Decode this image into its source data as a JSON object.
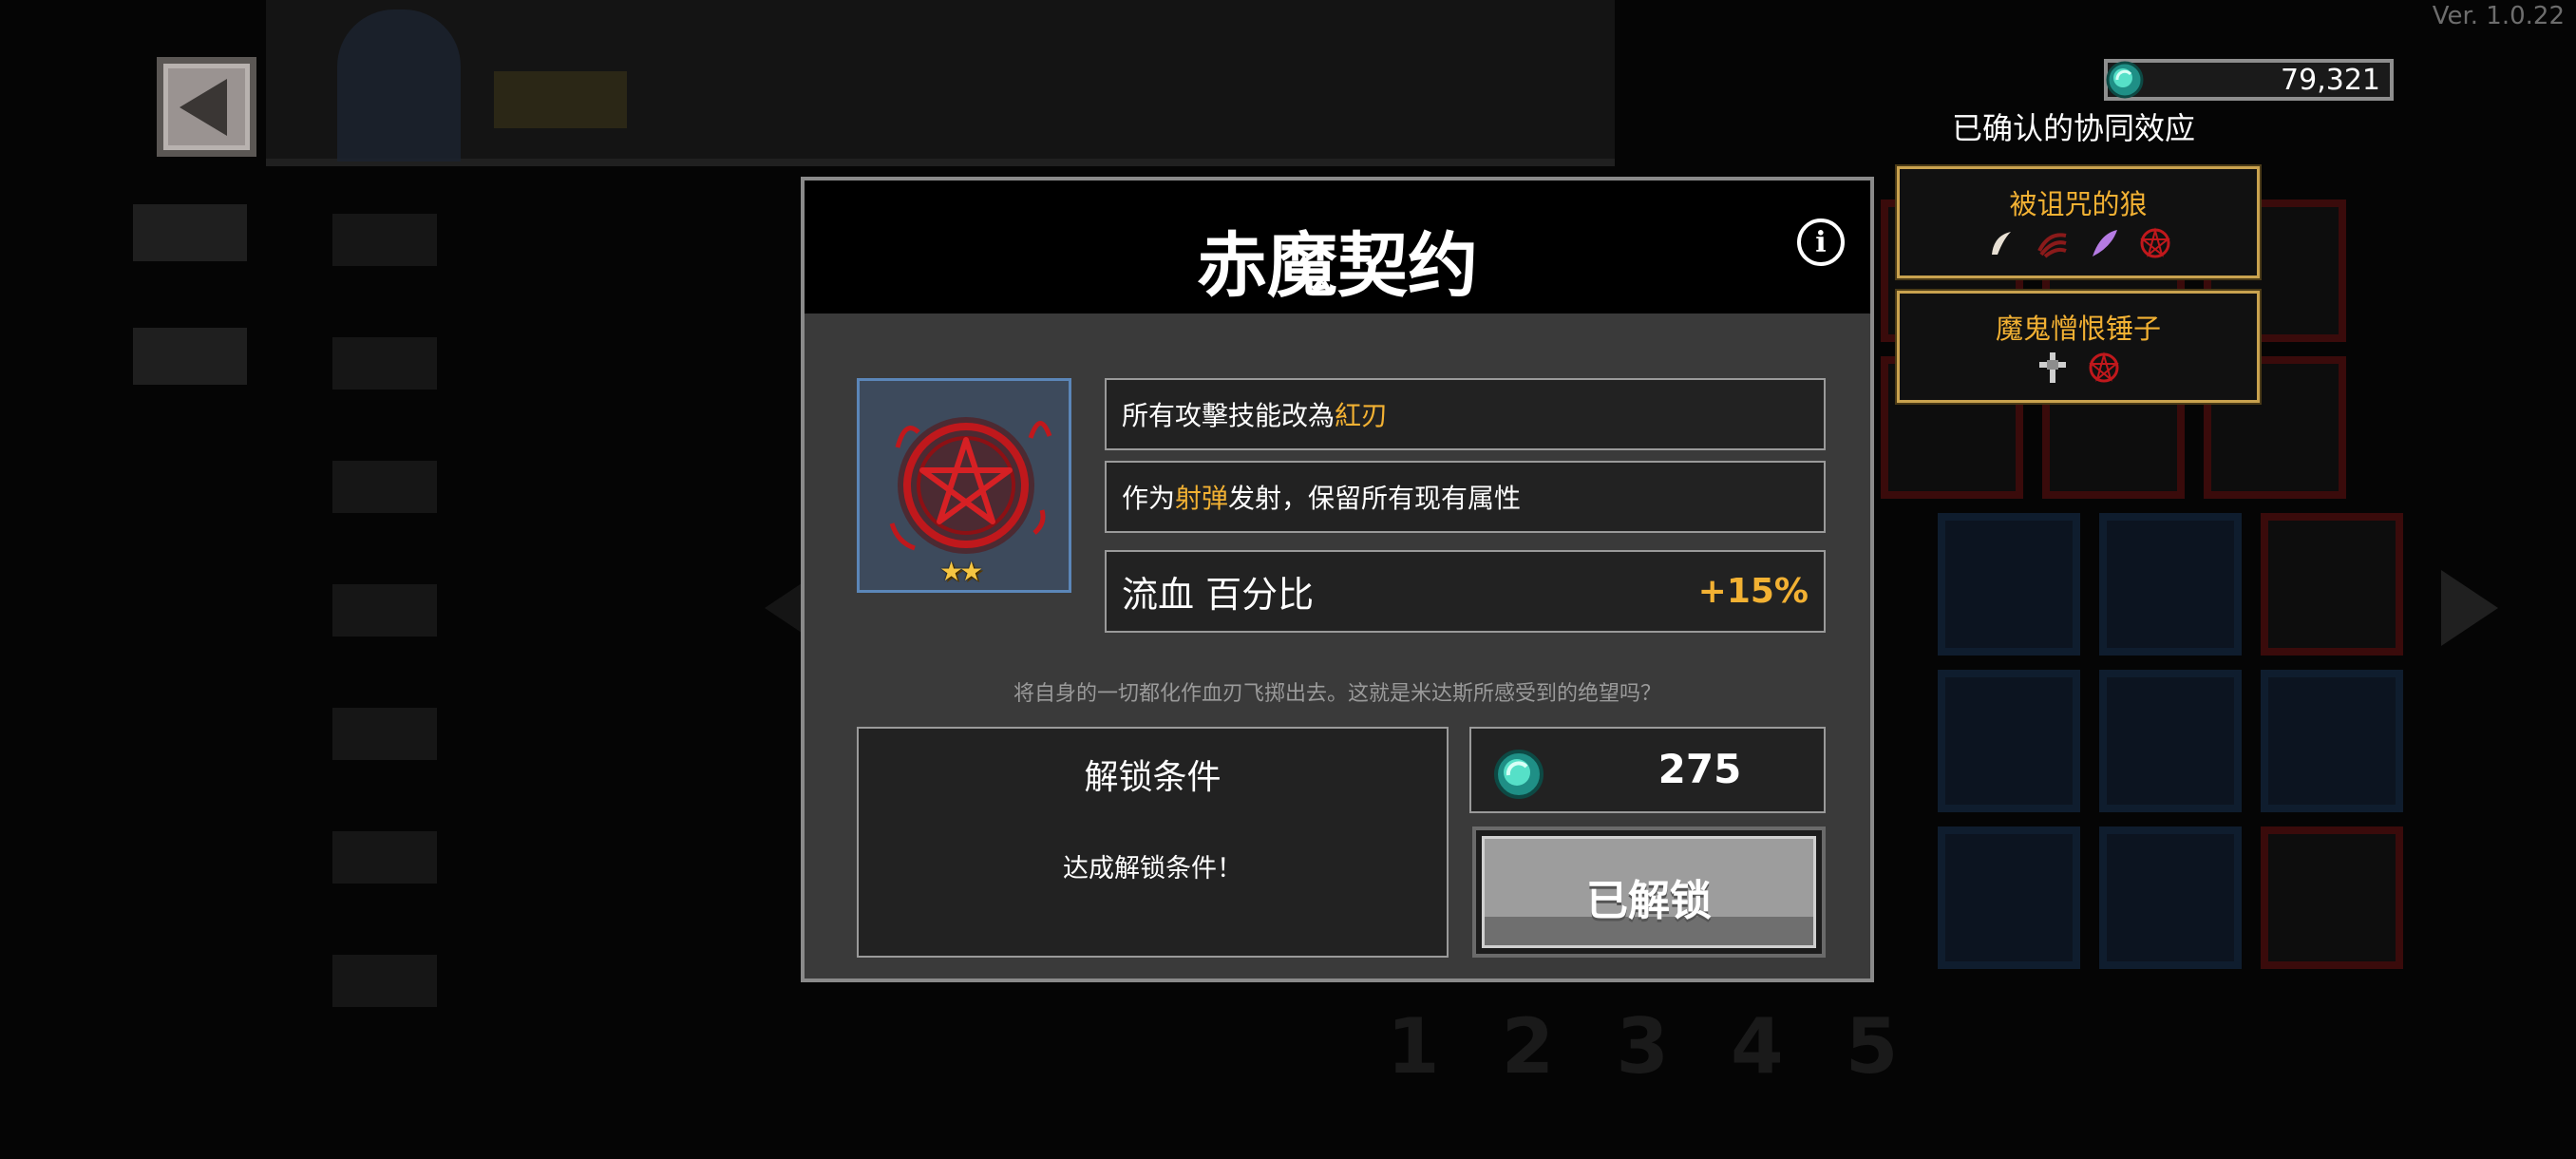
{
  "version": "Ver. 1.0.22",
  "currency": {
    "icon": "teal-gem-icon",
    "value": "79,321"
  },
  "synergy": {
    "title": "已确认的协同效应",
    "cards": [
      {
        "name": "被诅咒的狼",
        "icons": [
          "fang-icon",
          "wolf-claw-icon",
          "purple-feather-icon",
          "pentagram-icon"
        ]
      },
      {
        "name": "魔鬼憎恨锤子",
        "icons": [
          "cross-hammer-icon",
          "pentagram-icon"
        ]
      }
    ]
  },
  "background_pages": [
    "1",
    "2",
    "3",
    "4",
    "5"
  ],
  "dialog": {
    "title": "赤魔契约",
    "item": {
      "icon": "red-pentagram-icon",
      "stars": "★★",
      "star_count": 2
    },
    "effects": [
      {
        "prefix": "所有攻擊技能改為",
        "highlight": "紅刃",
        "suffix": ""
      },
      {
        "prefix": "作为",
        "highlight": "射弹",
        "suffix": "发射，保留所有现有属性"
      }
    ],
    "stat": {
      "label": "流血 百分比",
      "value": "+15%"
    },
    "flavor": "将自身的一切都化作血刃飞掷出去。这就是米达斯所感受到的绝望吗？",
    "unlock": {
      "title": "解锁条件",
      "desc": "达成解锁条件！"
    },
    "price": "275",
    "button_label": "已解锁"
  },
  "colors": {
    "accent_gold": "#f2b133",
    "dialog_bg": "#3a3a3a",
    "item_frame": "#5b86b8",
    "blood_red": "#c0181c"
  }
}
